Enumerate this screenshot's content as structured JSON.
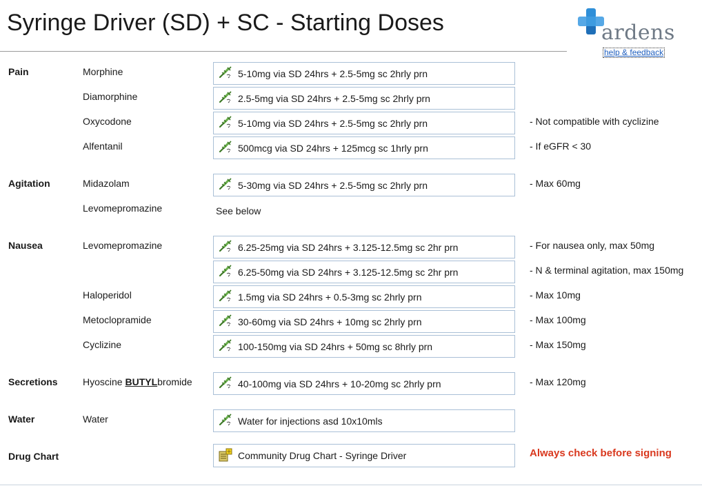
{
  "header": {
    "title": "Syringe Driver (SD) + SC - Starting Doses",
    "logo_text": "ardens",
    "help_link": "help & feedback",
    "brand_color": "#2f8fd8"
  },
  "categories": {
    "pain": "Pain",
    "agitation": "Agitation",
    "nausea": "Nausea",
    "secretions": "Secretions",
    "water": "Water",
    "drug_chart": "Drug Chart"
  },
  "drugs": {
    "morphine": "Morphine",
    "diamorphine": "Diamorphine",
    "oxycodone": "Oxycodone",
    "alfentanil": "Alfentanil",
    "midazolam": "Midazolam",
    "levomepromazine_agitation": "Levomepromazine",
    "levomepromazine_nausea": "Levomepromazine",
    "haloperidol": "Haloperidol",
    "metoclopramide": "Metoclopramide",
    "cyclizine": "Cyclizine",
    "hyoscine_prefix": "Hyoscine ",
    "hyoscine_bold": "BUTYL",
    "hyoscine_suffix": "bromide",
    "water": "Water"
  },
  "doses": {
    "morphine": "5-10mg via SD 24hrs + 2.5-5mg sc 2hrly prn",
    "diamorphine": "2.5-5mg via SD 24hrs + 2.5-5mg sc 2hrly prn",
    "oxycodone": "5-10mg via SD 24hrs + 2.5-5mg sc 2hrly prn",
    "alfentanil": "500mcg via SD 24hrs + 125mcg sc 1hrly prn",
    "midazolam": "5-30mg via SD 24hrs + 2.5-5mg sc 2hrly prn",
    "levomepromazine_agitation": "See below",
    "levomepromazine_1": "6.25-25mg via SD 24hrs + 3.125-12.5mg sc 2hr prn",
    "levomepromazine_2": "6.25-50mg via SD 24hrs + 3.125-12.5mg sc 2hr prn",
    "haloperidol": "1.5mg via SD 24hrs + 0.5-3mg sc 2hrly prn",
    "metoclopramide": "30-60mg via SD 24hrs + 10mg sc 2hrly prn",
    "cyclizine": "100-150mg via SD 24hrs + 50mg sc 8hrly prn",
    "hyoscine": "40-100mg via SD 24hrs + 10-20mg sc 2hrly prn",
    "water": "Water for injections asd 10x10mls",
    "drug_chart": "Community Drug Chart - Syringe Driver"
  },
  "notes": {
    "oxycodone": "- Not compatible with cyclizine",
    "alfentanil": "- If eGFR < 30",
    "midazolam": "- Max 60mg",
    "levomepromazine_1": "- For nausea only, max 50mg",
    "levomepromazine_2": "- N & terminal agitation, max 150mg",
    "haloperidol": "- Max 10mg",
    "metoclopramide": "- Max 100mg",
    "cyclizine": "- Max 150mg",
    "hyoscine": "- Max 120mg",
    "drug_chart_warning": "Always check before signing",
    "warning_color": "#d9381e"
  },
  "icons": {
    "dose_icon": "syringe-prescribe-icon",
    "chart_icon": "document-star-icon"
  }
}
